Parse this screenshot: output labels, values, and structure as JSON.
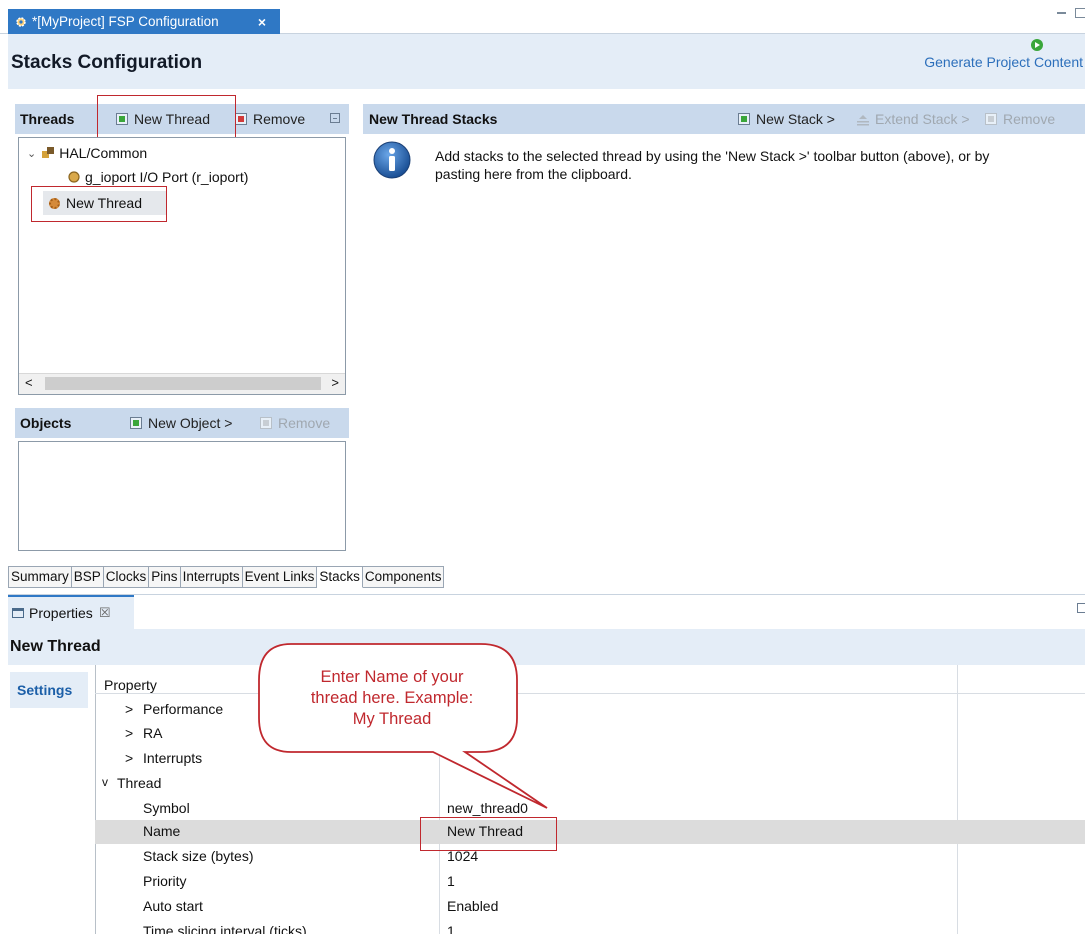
{
  "editor": {
    "tab_title": "*[MyProject] FSP Configuration",
    "tab_close": "×"
  },
  "header": {
    "title": "Stacks Configuration",
    "generate_label": "Generate Project Content"
  },
  "threads_panel": {
    "title": "Threads",
    "new_thread_label": "New Thread",
    "remove_label": "Remove",
    "tree": [
      {
        "label": "HAL/Common"
      },
      {
        "label": "g_ioport I/O Port (r_ioport)"
      },
      {
        "label": "New Thread"
      }
    ],
    "scroll_left": "<",
    "scroll_right": ">"
  },
  "objects_panel": {
    "title": "Objects",
    "new_object_label": "New Object >",
    "remove_label": "Remove"
  },
  "stacks_panel": {
    "title": "New Thread Stacks",
    "new_stack_label": "New Stack >",
    "extend_stack_label": "Extend Stack >",
    "remove_label": "Remove",
    "info_line1": "Add stacks to the selected thread by using the 'New Stack >' toolbar button (above), or by",
    "info_line2": "pasting here from the clipboard."
  },
  "page_tabs": [
    "Summary",
    "BSP",
    "Clocks",
    "Pins",
    "Interrupts",
    "Event Links",
    "Stacks",
    "Components"
  ],
  "page_tabs_active": "Stacks",
  "properties": {
    "tab_label": "Properties",
    "tab_close": "☒",
    "heading": "New Thread",
    "settings_tab": "Settings",
    "column_header": "Property",
    "rows": [
      {
        "property": "Performance",
        "value": "",
        "level": 1,
        "expander": ">"
      },
      {
        "property": "RA",
        "value": "",
        "level": 1,
        "expander": ">"
      },
      {
        "property": "Interrupts",
        "value": "",
        "level": 1,
        "expander": ">"
      },
      {
        "property": "Thread",
        "value": "",
        "level": 0,
        "expander": "v"
      },
      {
        "property": "Symbol",
        "value": "new_thread0",
        "level": 2
      },
      {
        "property": "Name",
        "value": "New Thread",
        "level": 2,
        "selected": true
      },
      {
        "property": "Stack size (bytes)",
        "value": "1024",
        "level": 2
      },
      {
        "property": "Priority",
        "value": "1",
        "level": 2
      },
      {
        "property": "Auto start",
        "value": "Enabled",
        "level": 2
      },
      {
        "property": "Time slicing interval (ticks)",
        "value": "1",
        "level": 2
      }
    ]
  },
  "callout": {
    "line1": "Enter Name of your",
    "line2": "thread here. Example:",
    "line3": "My Thread"
  },
  "colors": {
    "accent_blue": "#2f78c5",
    "panel_header": "#c9d9ec",
    "highlight_red": "#c0282e"
  }
}
